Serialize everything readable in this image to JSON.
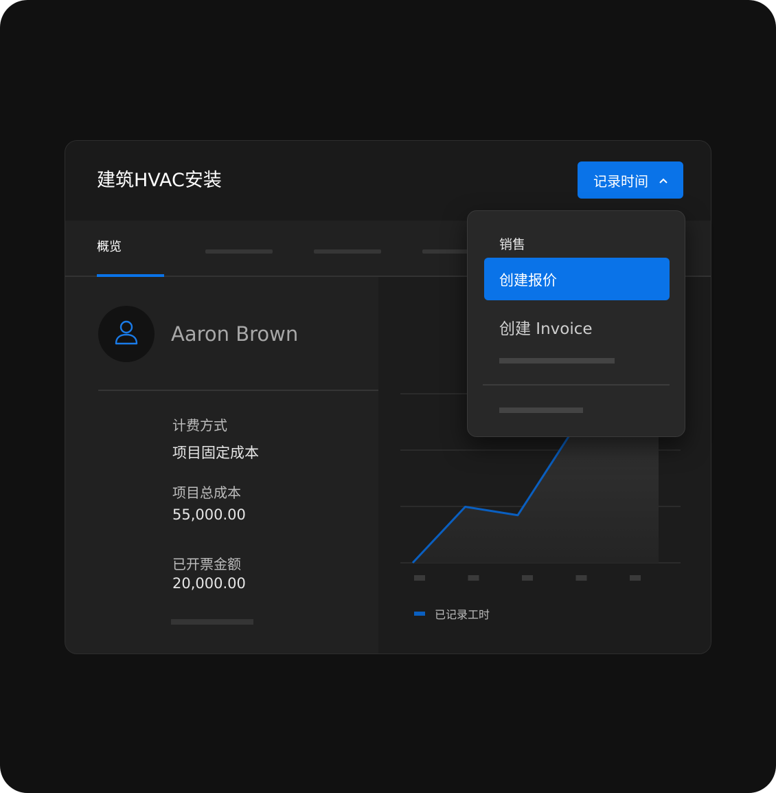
{
  "header": {
    "project_title": "建筑HVAC安装",
    "log_time_button": "记录时间",
    "chevron_icon": "chevron-up-icon"
  },
  "tabs": {
    "active_label": "概览"
  },
  "client": {
    "name": "Aaron Brown",
    "avatar_icon": "user-icon"
  },
  "fields": [
    {
      "label": "计费方式",
      "value": "项目固定成本"
    },
    {
      "label": "项目总成本",
      "value": "55,000.00"
    },
    {
      "label": "已开票金额",
      "value": "20,000.00"
    }
  ],
  "dropdown": {
    "header": "销售",
    "items": [
      "创建报价",
      "创建 Invoice"
    ]
  },
  "legend": {
    "label": "已记录工时"
  },
  "colors": {
    "accent": "#0a73e8",
    "line": "#0a5fc0"
  },
  "chart_data": {
    "type": "area",
    "x": [
      1,
      2,
      3,
      4,
      5
    ],
    "values": [
      0,
      1.0,
      0.85,
      2.3,
      3.8
    ],
    "ylim": [
      0,
      4
    ],
    "grid": true,
    "legend": "bottom-left",
    "series": [
      {
        "name": "已记录工时"
      }
    ]
  }
}
